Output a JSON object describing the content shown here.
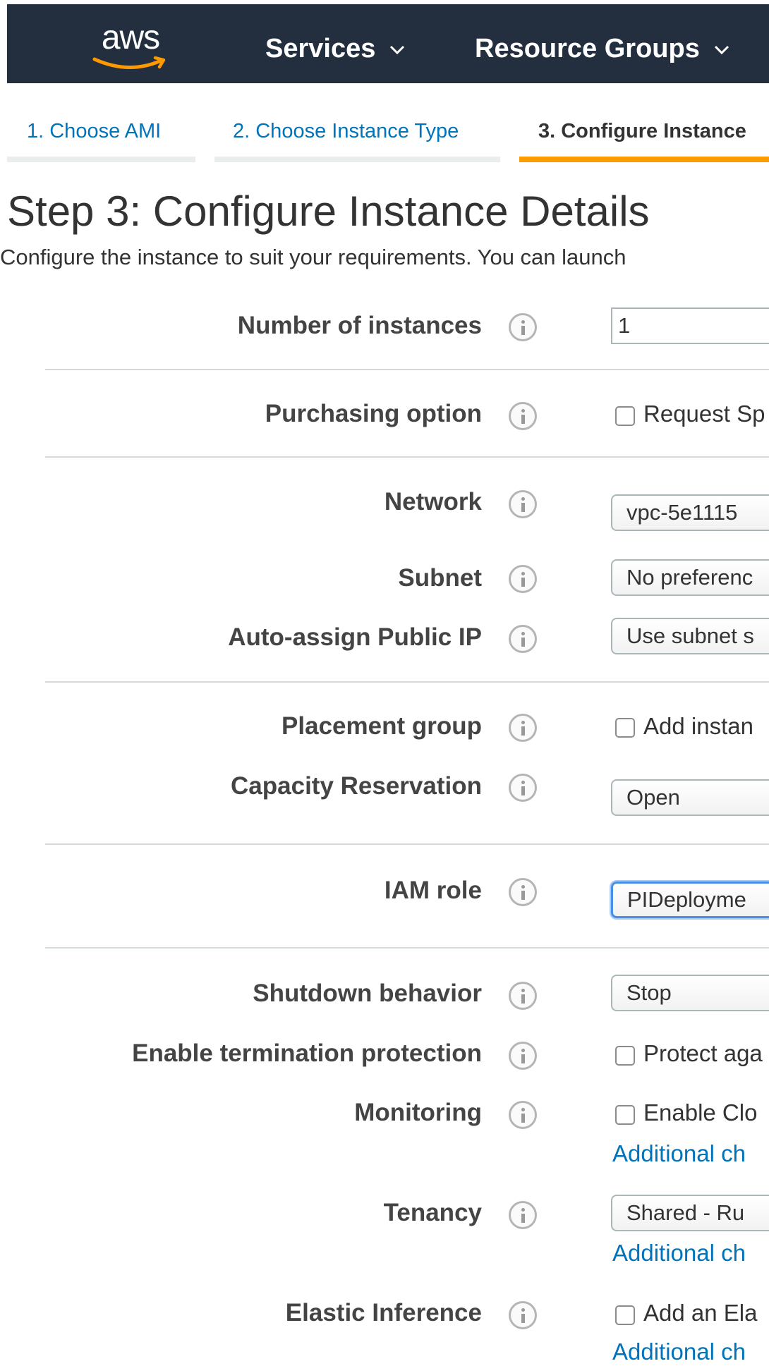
{
  "header": {
    "logo_text": "aws",
    "nav": [
      {
        "label": "Services"
      },
      {
        "label": "Resource Groups"
      }
    ]
  },
  "wizard_tabs": [
    {
      "label": "1. Choose AMI",
      "active": false
    },
    {
      "label": "2. Choose Instance Type",
      "active": false
    },
    {
      "label": "3. Configure Instance",
      "active": true
    }
  ],
  "page": {
    "title": "Step 3: Configure Instance Details",
    "description": "Configure the instance to suit your requirements. You can launch"
  },
  "fields": {
    "number_of_instances": {
      "label": "Number of instances",
      "value": "1"
    },
    "purchasing_option": {
      "label": "Purchasing option",
      "checkbox_label": "Request Sp",
      "checked": false
    },
    "network": {
      "label": "Network",
      "value": "vpc-5e1115"
    },
    "subnet": {
      "label": "Subnet",
      "value": "No preferenc"
    },
    "auto_assign_ip": {
      "label": "Auto-assign Public IP",
      "value": "Use subnet s"
    },
    "placement_group": {
      "label": "Placement group",
      "checkbox_label": "Add instan",
      "checked": false
    },
    "capacity_reservation": {
      "label": "Capacity Reservation",
      "value": "Open"
    },
    "iam_role": {
      "label": "IAM role",
      "value": "PIDeployme"
    },
    "shutdown_behavior": {
      "label": "Shutdown behavior",
      "value": "Stop"
    },
    "termination_protection": {
      "label": "Enable termination protection",
      "checkbox_label": "Protect aga",
      "checked": false
    },
    "monitoring": {
      "label": "Monitoring",
      "checkbox_label": "Enable Clo",
      "checked": false,
      "link": "Additional ch"
    },
    "tenancy": {
      "label": "Tenancy",
      "value": "Shared - Ru",
      "link": "Additional ch"
    },
    "elastic_inference": {
      "label": "Elastic Inference",
      "checkbox_label": "Add an Ela",
      "checked": false,
      "link": "Additional ch"
    }
  },
  "colors": {
    "header_bg": "#232f3e",
    "accent": "#ff9900",
    "link": "#0073bb"
  }
}
